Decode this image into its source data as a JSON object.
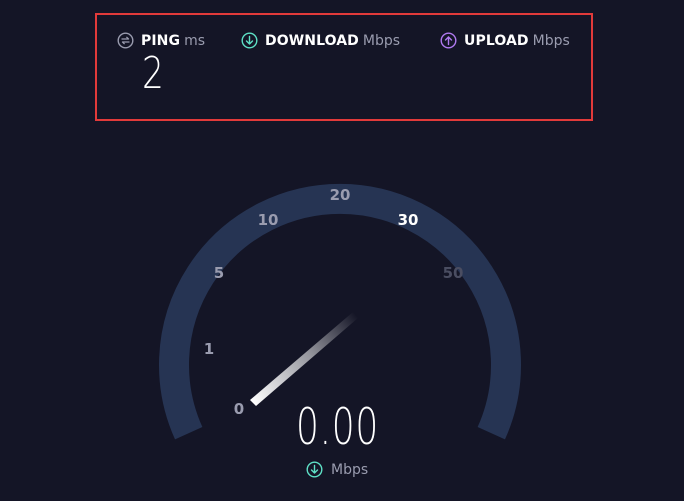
{
  "results": {
    "ping": {
      "label": "PING",
      "unit": "ms",
      "value": "2",
      "icon": "ping-icon"
    },
    "download": {
      "label": "DOWNLOAD",
      "unit": "Mbps",
      "icon": "download-icon",
      "color": "#5ee0c6"
    },
    "upload": {
      "label": "UPLOAD",
      "unit": "Mbps",
      "icon": "upload-icon",
      "color": "#b07af0"
    }
  },
  "gauge": {
    "ticks": [
      "0",
      "1",
      "5",
      "10",
      "20",
      "30",
      "50"
    ],
    "active_tick": "30",
    "current_speed": "0.00",
    "speed_unit": "Mbps",
    "track_color": "#263453",
    "highlight_color": "#e23a3a"
  }
}
